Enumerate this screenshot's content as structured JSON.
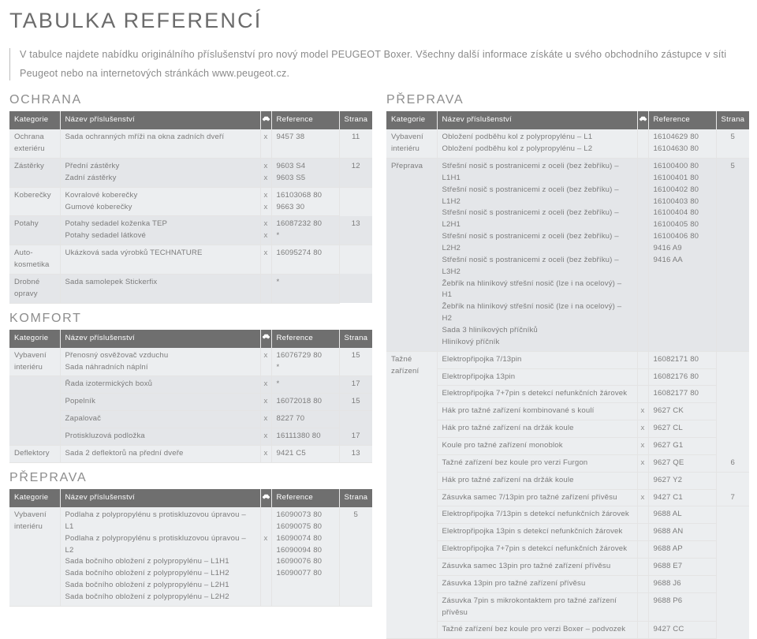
{
  "document": {
    "title": "TABULKA REFERENCÍ",
    "intro": "V tabulce najdete nabídku originálního příslušenství pro nový model PEUGEOT Boxer. Všechny další informace získáte u svého obchodního zástupce v síti Peugeot nebo na internetových stránkách www.peugeot.cz."
  },
  "colors": {
    "header_band": "#6f6f6f",
    "row_light": "#eceef0",
    "row_dark": "#e4e6e9",
    "text": "#7c7c7c",
    "title": "#6b6b6b"
  },
  "table_headers": {
    "kategorie": "Kategorie",
    "nazev": "Název příslušenství",
    "mark_icon": "car-icon",
    "reference": "Reference",
    "strana": "Strana"
  },
  "left_column": {
    "sections": [
      {
        "title": "OCHRANA",
        "rows": [
          {
            "kategorie": "Ochrana\nexteriéru",
            "items": [
              {
                "name": "Sada ochranných mříži na okna zadních dveří",
                "mark": "x",
                "reference": "9457 38"
              }
            ],
            "strana": "11"
          },
          {
            "kategorie": "Zástěrky",
            "items": [
              {
                "name": "Přední zástěrky",
                "mark": "x",
                "reference": "9603 S4"
              },
              {
                "name": "Zadní zástěrky",
                "mark": "x",
                "reference": "9603 S5"
              }
            ],
            "strana": "12"
          },
          {
            "kategorie": "Koberečky",
            "items": [
              {
                "name": "Kovralové koberečky",
                "mark": "x",
                "reference": "16103068 80"
              },
              {
                "name": "Gumové koberečky",
                "mark": "x",
                "reference": "9663 30"
              }
            ],
            "strana": ""
          },
          {
            "kategorie": "Potahy",
            "items": [
              {
                "name": "Potahy sedadel koženka TEP",
                "mark": "x",
                "reference": "16087232 80"
              },
              {
                "name": "Potahy sedadel látkové",
                "mark": "x",
                "reference": "*"
              }
            ],
            "strana": "13"
          },
          {
            "kategorie": "Auto-\nkosmetika",
            "items": [
              {
                "name": "Ukázková sada výrobků TECHNATURE",
                "mark": "x",
                "reference": "16095274 80"
              }
            ],
            "strana": ""
          },
          {
            "kategorie": "Drobné\nopravy",
            "items": [
              {
                "name": "Sada samolepek Stickerfix",
                "mark": "",
                "reference": "*"
              }
            ],
            "strana": ""
          }
        ]
      },
      {
        "title": "KOMFORT",
        "rows": [
          {
            "kategorie": "Vybavení\ninteriéru",
            "items": [
              {
                "name": "Přenosný osvěžovač vzduchu",
                "mark": "x",
                "reference": "16076729 80"
              },
              {
                "name": "Sada náhradních náplní",
                "mark": "",
                "reference": "*"
              }
            ],
            "strana": "15"
          },
          {
            "kategorie": "",
            "items": [
              {
                "name": "Řada izotermických boxů",
                "mark": "x",
                "reference": "*",
                "strana": "17"
              },
              {
                "name": "Popelník",
                "mark": "x",
                "reference": "16072018 80",
                "strana": "15"
              },
              {
                "name": "Zapalovač",
                "mark": "x",
                "reference": "8227 70",
                "strana": ""
              },
              {
                "name": "Protiskluzová podložka",
                "mark": "x",
                "reference": "16111380 80",
                "strana": "17"
              }
            ],
            "strana": ""
          },
          {
            "kategorie": "Deflektory",
            "items": [
              {
                "name": "Sada 2 deflektorů na přední dveře",
                "mark": "x",
                "reference": "9421 C5"
              }
            ],
            "strana": "13"
          }
        ]
      },
      {
        "title": "PŘEPRAVA",
        "rows": [
          {
            "kategorie": "Vybavení\ninteriéru",
            "items": [
              {
                "name": "Podlaha z polypropylénu s protiskluzovou úpravou – L1",
                "mark": "",
                "reference": "16090073 80"
              },
              {
                "name": "Podlaha z polypropylénu s protiskluzovou úpravou – L2",
                "mark": "",
                "reference": "16090075 80"
              },
              {
                "name": "Sada bočního obložení z polypropylénu – L1H1",
                "mark": "x",
                "reference": "16090074 80"
              },
              {
                "name": "Sada bočního obložení z polypropylénu – L1H2",
                "mark": "",
                "reference": "16090094 80"
              },
              {
                "name": "Sada bočního obložení z polypropylénu – L2H1",
                "mark": "",
                "reference": "16090076 80"
              },
              {
                "name": "Sada bočního obložení z polypropylénu – L2H2",
                "mark": "",
                "reference": "16090077 80"
              }
            ],
            "strana": "5"
          }
        ]
      }
    ]
  },
  "right_column": {
    "sections": [
      {
        "title": "PŘEPRAVA",
        "rows": [
          {
            "kategorie": "Vybavení\ninteriéru",
            "items": [
              {
                "name": "Obložení podběhu kol z polypropylénu – L1",
                "mark": "",
                "reference": "16104629 80"
              },
              {
                "name": "Obložení podběhu kol z polypropylénu – L2",
                "mark": "",
                "reference": "16104630 80"
              }
            ],
            "strana": "5"
          },
          {
            "kategorie": "Přeprava",
            "items": [
              {
                "name": "Střešní nosič s postranicemi z oceli (bez žebříku) – L1H1",
                "mark": "",
                "reference": "16100400 80"
              },
              {
                "name": "Střešní nosič s postranicemi z oceli (bez žebříku) – L1H2",
                "mark": "",
                "reference": "16100401 80"
              },
              {
                "name": "Střešní nosič s postranicemi z oceli (bez žebříku) – L2H1",
                "mark": "",
                "reference": "16100402 80"
              },
              {
                "name": "Střešní nosič s postranicemi z oceli (bez žebříku) – L2H2",
                "mark": "",
                "reference": "16100403 80"
              },
              {
                "name": "Střešní nosič s postranicemi z oceli (bez žebříku) – L3H2",
                "mark": "",
                "reference": "16100404 80"
              },
              {
                "name": "Žebřík na hliníkový střešní nosič (lze i na ocelový) – H1",
                "mark": "",
                "reference": "16100405 80"
              },
              {
                "name": "Žebřík na hliníkový střešní nosič (lze i na ocelový) – H2",
                "mark": "",
                "reference": "16100406 80"
              },
              {
                "name": "Sada 3 hliníkových příčníků",
                "mark": "",
                "reference": "9416 A9"
              },
              {
                "name": "Hliníkový příčník",
                "mark": "",
                "reference": "9416 AA"
              }
            ],
            "strana": "5"
          },
          {
            "kategorie": "Tažné\nzařízení",
            "items": [
              {
                "name": "Elektropřipojka 7/13pin",
                "mark": "",
                "reference": "16082171 80",
                "strana": ""
              },
              {
                "name": "Elektropřipojka 13pin",
                "mark": "",
                "reference": "16082176 80",
                "strana": ""
              },
              {
                "name": "Elektropřipojka 7+7pin s detekcí nefunkčních žárovek",
                "mark": "",
                "reference": "16082177 80",
                "strana": ""
              },
              {
                "name": "Hák pro tažné zařízení kombinované s koulí",
                "mark": "x",
                "reference": "9627 CK",
                "strana": ""
              },
              {
                "name": "Hák pro tažné zařízení na držák koule",
                "mark": "x",
                "reference": "9627 CL",
                "strana": ""
              },
              {
                "name": "Koule pro tažné zařízení monoblok",
                "mark": "x",
                "reference": "9627 G1",
                "strana": ""
              },
              {
                "name": "Tažné zařízení bez koule pro verzi Furgon",
                "mark": "x",
                "reference": "9627 QE",
                "strana": "6"
              },
              {
                "name": "Hák pro tažné zařízení na držák koule",
                "mark": "",
                "reference": "9627 Y2",
                "strana": ""
              },
              {
                "name": "Zásuvka samec 7/13pin pro tažné zařízení přívěsu",
                "mark": "x",
                "reference": "9427 C1",
                "strana": "7"
              },
              {
                "name": "Elektropřipojka 7/13pin s detekcí nefunkčních žárovek",
                "mark": "",
                "reference": "9688 AL",
                "strana": ""
              },
              {
                "name": "Elektropřipojka 13pin s detekcí nefunkčních žárovek",
                "mark": "",
                "reference": "9688 AN",
                "strana": ""
              },
              {
                "name": "Elektropřipojka 7+7pin s detekcí nefunkčních žárovek",
                "mark": "",
                "reference": "9688 AP",
                "strana": ""
              },
              {
                "name": "Zásuvka samec 13pin pro tažné zařízení přívěsu",
                "mark": "",
                "reference": "9688 E7",
                "strana": ""
              },
              {
                "name": "Zásuvka 13pin pro tažné zařízení přívěsu",
                "mark": "",
                "reference": "9688 J6",
                "strana": ""
              },
              {
                "name": "Zásuvka 7pin s mikrokontaktem pro tažné zařízení přívěsu",
                "mark": "",
                "reference": "9688 P6",
                "strana": ""
              },
              {
                "name": "Tažné zařízení bez koule pro verzi Boxer – podvozek",
                "mark": "",
                "reference": "9427 CC",
                "strana": ""
              }
            ],
            "strana": ""
          }
        ]
      }
    ]
  }
}
